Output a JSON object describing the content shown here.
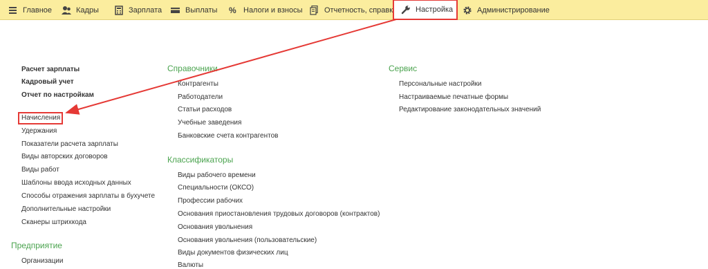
{
  "topbar": {
    "tabs": [
      {
        "label": "Главное",
        "icon": "menu-icon"
      },
      {
        "label": "Кадры",
        "icon": "people-icon"
      },
      {
        "label": "Зарплата",
        "icon": "calculator-icon"
      },
      {
        "label": "Выплаты",
        "icon": "card-icon"
      },
      {
        "label": "Налоги и взносы",
        "icon": "percent-icon"
      },
      {
        "label": "Отчетность, справки",
        "icon": "documents-icon"
      },
      {
        "label": "Настройка",
        "icon": "wrench-icon"
      },
      {
        "label": "Администрирование",
        "icon": "gear-icon"
      }
    ],
    "active_tab": "Настройка"
  },
  "left": {
    "top_links": [
      "Расчет зарплаты",
      "Кадровый учет",
      "Отчет по настройкам"
    ],
    "links": [
      "Начисления",
      "Удержания",
      "Показатели расчета зарплаты",
      "Виды авторских договоров",
      "Виды работ",
      "Шаблоны ввода исходных данных",
      "Способы отражения зарплаты в бухучете",
      "Дополнительные настройки",
      "Сканеры штрихкода"
    ],
    "enterprise_title": "Предприятие",
    "enterprise_links": [
      "Организации"
    ]
  },
  "middle": {
    "reference_title": "Справочники",
    "reference_links": [
      "Контрагенты",
      "Работодатели",
      "Статьи расходов",
      "Учебные заведения",
      "Банковские счета контрагентов"
    ],
    "classifiers_title": "Классификаторы",
    "classifiers_links": [
      "Виды рабочего времени",
      "Специальности (ОКСО)",
      "Профессии рабочих",
      "Основания приостановления трудовых договоров (контрактов)",
      "Основания увольнения",
      "Основания увольнения (пользовательские)",
      "Виды документов физических лиц",
      "Валюты"
    ]
  },
  "right": {
    "service_title": "Сервис",
    "service_links": [
      "Персональные настройки",
      "Настраиваемые печатные формы",
      "Редактирование законодательных значений"
    ]
  },
  "colors": {
    "topbar": "#fbed9e",
    "section_title": "#4aa34e",
    "highlight": "#e53935"
  }
}
